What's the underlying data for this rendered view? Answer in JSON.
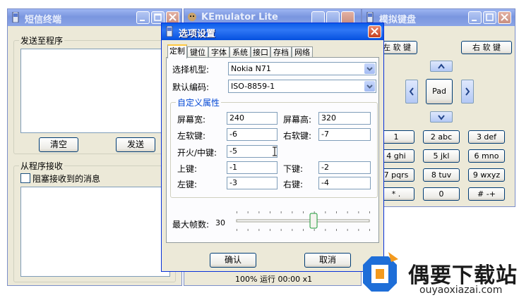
{
  "sms_window": {
    "title": "短信终端",
    "send_group": "发送至程序",
    "clear_button": "清空",
    "send_button": "发送",
    "receive_group": "从程序接收",
    "block_checkbox": "阻塞接收到的消息"
  },
  "emulator_window": {
    "title": "KEmulator Lite",
    "status": "100% 运行 00:00 x1"
  },
  "keyboard_window": {
    "title": "模拟键盘",
    "left_soft": "左 软 键",
    "right_soft": "右 软 键",
    "pad": "Pad",
    "keys": [
      "1",
      "2 abc",
      "3 def",
      "4 ghi",
      "5 jkl",
      "6 mno",
      "7 pqrs",
      "8 tuv",
      "9 wxyz",
      "* .",
      "0",
      "# -+"
    ]
  },
  "options_dialog": {
    "title": "选项设置",
    "tabs": [
      "定制",
      "键位",
      "字体",
      "系统",
      "接口",
      "存档",
      "网络"
    ],
    "active_tab": "定制",
    "model_label": "选择机型:",
    "model_value": "Nokia N71",
    "encoding_label": "默认编码:",
    "encoding_value": "ISO-8859-1",
    "custom_group": "自定义属性",
    "fields": {
      "screen_width": {
        "label": "屏幕宽:",
        "value": "240"
      },
      "screen_height": {
        "label": "屏幕高:",
        "value": "320"
      },
      "left_soft": {
        "label": "左软键:",
        "value": "-6"
      },
      "right_soft": {
        "label": "右软键:",
        "value": "-7"
      },
      "fire": {
        "label": "开火/中键:",
        "value": "-5"
      },
      "up": {
        "label": "上键:",
        "value": "-1"
      },
      "down": {
        "label": "下键:",
        "value": "-2"
      },
      "left": {
        "label": "左键:",
        "value": "-3"
      },
      "right": {
        "label": "右键:",
        "value": "-4"
      }
    },
    "fps_label": "最大帧数:",
    "fps_value": "30",
    "fps_fraction": 0.58,
    "ok_button": "确认",
    "cancel_button": "取消"
  },
  "watermark": {
    "name": "偶要下载站",
    "url": "ouyaoxiazai.com"
  },
  "colors": {
    "title_active": "#0a5ce8",
    "title_inactive": "#8aa4e6",
    "window_face": "#ece9d8",
    "watermark_text": "#1a1a1a",
    "logo_blue": "#1e6ed8",
    "logo_orange": "#f39a1e"
  }
}
